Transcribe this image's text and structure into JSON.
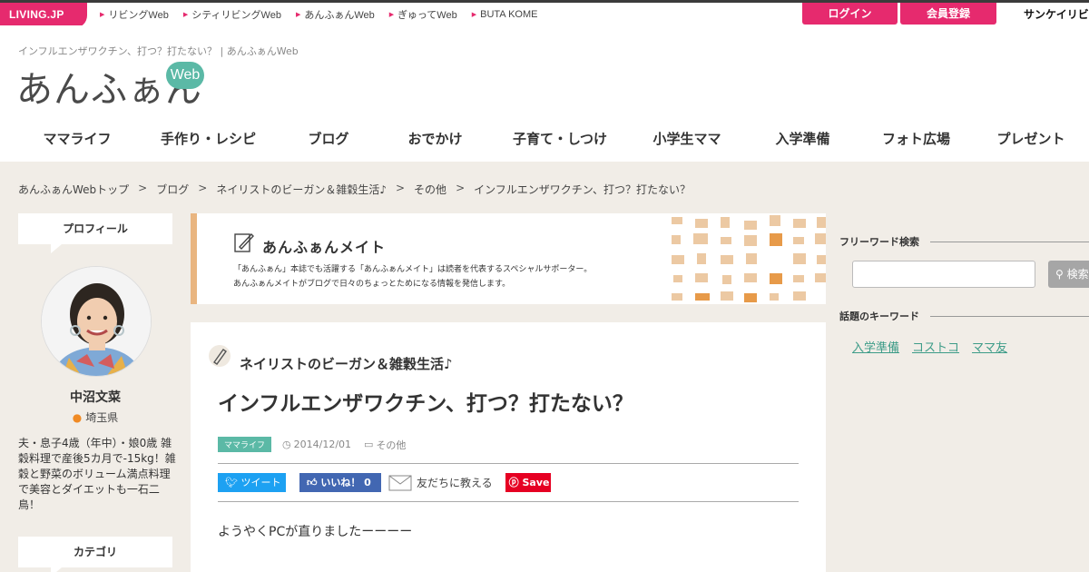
{
  "netbar": {
    "logo": "LIVING.JP",
    "links": [
      "リビングWeb",
      "シティリビングWeb",
      "あんふぁんWeb",
      "ぎゅってWeb",
      "BUTA KOME"
    ],
    "login": "ログイン",
    "register": "会員登録",
    "partner": "サンケイリビ"
  },
  "header": {
    "tagline": "インフルエンザワクチン、打つ？打たない？ | あんふぁんWeb",
    "logo": "あんふぁん",
    "logo_badge": "Web",
    "nav": [
      "ママライフ",
      "手作り・レシピ",
      "ブログ",
      "おでかけ",
      "子育て・しつけ",
      "小学生ママ",
      "入学準備",
      "フォト広場",
      "プレゼント"
    ]
  },
  "breadcrumb": [
    "あんふぁんWebトップ",
    "ブログ",
    "ネイリストのビーガン＆雑穀生活♪",
    "その他",
    "インフルエンザワクチン、打つ？打たない？"
  ],
  "sidebar": {
    "profile_title": "プロフィール",
    "name": "中沼文菜",
    "location": "埼玉県",
    "description": "夫・息子4歳（年中）・娘0歳 雑穀料理で産後5カ月で-15kg！雑穀と野菜のボリューム満点料理で美容とダイエットも一石二鳥！",
    "category_title": "カテゴリ"
  },
  "banner": {
    "title": "あんふぁんメイト",
    "line1": "「あんふぁん」本誌でも活躍する「あんふぁんメイト」は読者を代表するスペシャルサポーター。",
    "line2": "あんふぁんメイトがブログで日々のちょっとためになる情報を発信します。"
  },
  "article": {
    "blog_name": "ネイリストのビーガン＆雑穀生活♪",
    "title": "インフルエンザワクチン、打つ？打たない？",
    "category": "ママライフ",
    "date": "2014/12/01",
    "folder": "その他",
    "share_tweet": "ツイート",
    "share_like": "いいね！ 0",
    "share_line": "友だちに教える",
    "share_pin": "Save",
    "body": "ようやくPCが直りましたーーーー"
  },
  "right": {
    "search_title": "フリーワード検索",
    "search_button": "検索",
    "keyword_title": "話題のキーワード",
    "keywords": [
      "入学準備",
      "コストコ",
      "ママ友"
    ]
  },
  "colors": {
    "accent_pink": "#e62a6e",
    "accent_teal": "#5bb9a6",
    "banner_orange": "#e9b580"
  }
}
